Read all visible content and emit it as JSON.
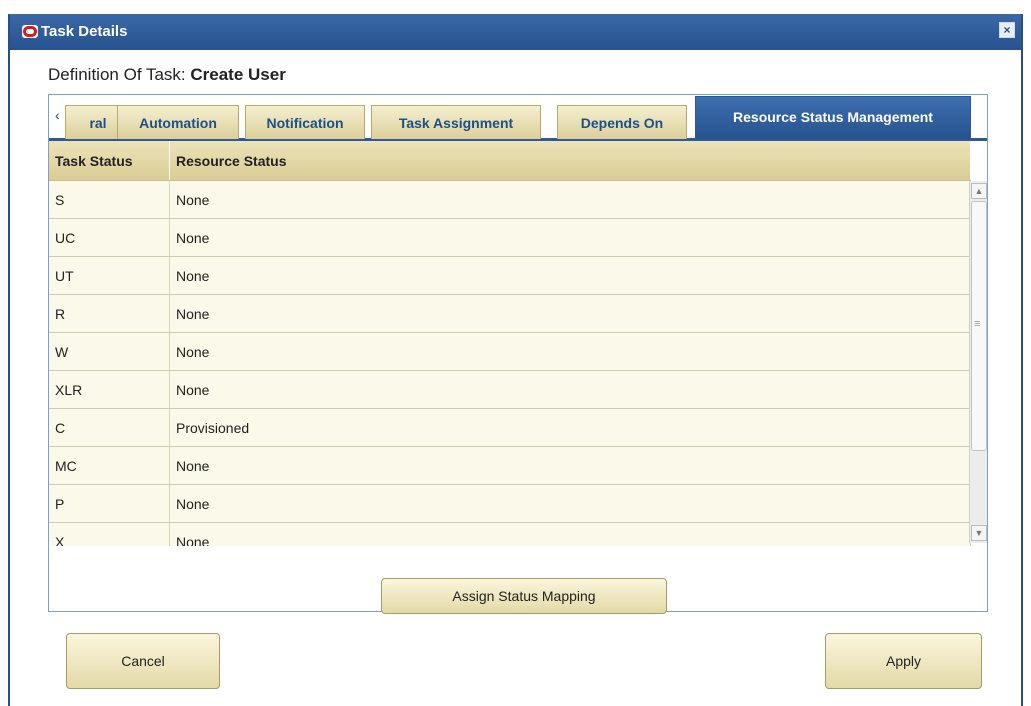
{
  "window": {
    "title": "Task Details",
    "close_label": "×"
  },
  "definition": {
    "label": "Definition Of Task:",
    "value": "Create User"
  },
  "tabs": {
    "scroll_left": "‹",
    "items": [
      {
        "label": "ral",
        "active": false
      },
      {
        "label": "Automation",
        "active": false
      },
      {
        "label": "Notification",
        "active": false
      },
      {
        "label": "Task Assignment",
        "active": false
      },
      {
        "label": "Depends On",
        "active": false
      },
      {
        "label": "Resource Status Management",
        "active": true
      }
    ]
  },
  "table": {
    "headers": [
      "Task Status",
      "Resource Status"
    ],
    "rows": [
      {
        "task_status": "S",
        "resource_status": "None"
      },
      {
        "task_status": "UC",
        "resource_status": "None"
      },
      {
        "task_status": "UT",
        "resource_status": "None"
      },
      {
        "task_status": "R",
        "resource_status": "None"
      },
      {
        "task_status": "W",
        "resource_status": "None"
      },
      {
        "task_status": "XLR",
        "resource_status": "None"
      },
      {
        "task_status": "C",
        "resource_status": "Provisioned"
      },
      {
        "task_status": "MC",
        "resource_status": "None"
      },
      {
        "task_status": "P",
        "resource_status": "None"
      },
      {
        "task_status": "X",
        "resource_status": "None"
      }
    ]
  },
  "buttons": {
    "assign": "Assign Status Mapping",
    "cancel": "Cancel",
    "apply": "Apply"
  },
  "colors": {
    "titlebar": "#27528f",
    "tab_active": "#2d5a97",
    "tab_inactive": "#dccf9a",
    "row_background": "#fbf9e9"
  }
}
